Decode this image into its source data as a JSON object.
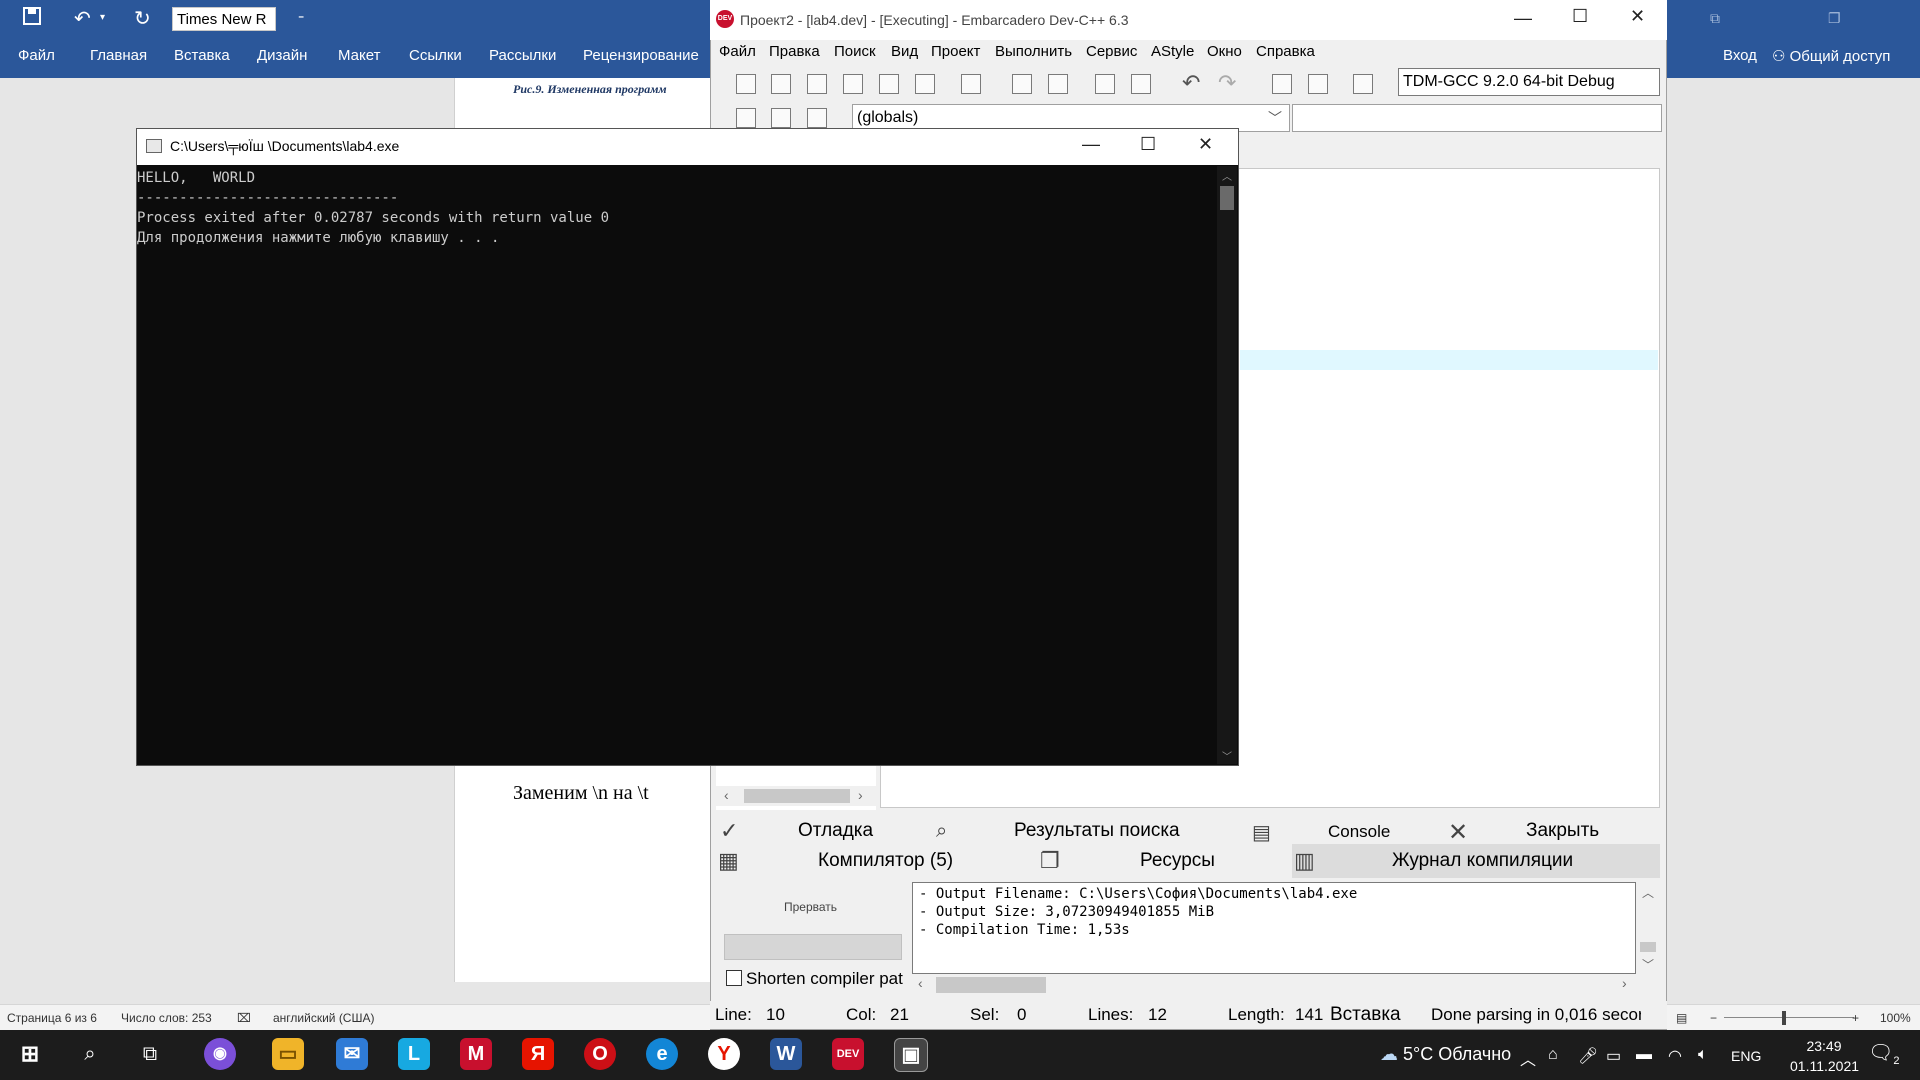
{
  "word": {
    "font_name": "Times New R",
    "menu": [
      "Файл",
      "Главная",
      "Вставка",
      "Дизайн",
      "Макет",
      "Ссылки",
      "Рассылки",
      "Рецензирование"
    ],
    "login": "Вход",
    "share": "Общий доступ",
    "caption": "Рис.9. Измененная программ",
    "doc_text": "Заменим \\n на \\t",
    "status": {
      "page": "Страница 6 из 6",
      "words": "Число слов: 253",
      "language": "английский (США)",
      "zoom": "100%"
    }
  },
  "devcpp": {
    "title": "Проект2 - [lab4.dev] - [Executing] - Embarcadero Dev-C++ 6.3",
    "logo": "DEV C++",
    "menu": [
      "Файл",
      "Правка",
      "Поиск",
      "Вид",
      "Проект",
      "Выполнить",
      "Сервис",
      "AStyle",
      "Окно",
      "Справка"
    ],
    "compiler": "TDM-GCC 9.2.0 64-bit Debug",
    "globals": "(globals)",
    "tabs": {
      "debug": "Отладка",
      "search_results": "Результаты поиска",
      "console": "Console",
      "close": "Закрыть",
      "compiler": "Компилятор (5)",
      "resources": "Ресурсы",
      "compile_log": "Журнал компиляции"
    },
    "abort": "Прервать",
    "shorten": "Shorten compiler pat",
    "log": [
      "- Output Filename: C:\\Users\\София\\Documents\\lab4.exe",
      "- Output Size: 3,07230949401855 MiB",
      "- Compilation Time: 1,53s"
    ],
    "status": {
      "line_label": "Line:",
      "line": "10",
      "col_label": "Col:",
      "col": "21",
      "sel_label": "Sel:",
      "sel": "0",
      "lines_label": "Lines:",
      "lines": "12",
      "length_label": "Length:",
      "length": "141",
      "mode": "Вставка",
      "parsing": "Done parsing in 0,016 secor"
    }
  },
  "console": {
    "title": "C:\\Users\\╤юЇш \\Documents\\lab4.exe",
    "lines": [
      "HELLO,   WORLD",
      "-------------------------------",
      "Process exited after 0.02787 seconds with return value 0",
      "Для продолжения нажмите любую клавишу . . ."
    ]
  },
  "taskbar": {
    "weather": "5°C  Облачно",
    "lang": "ENG",
    "time": "23:49",
    "date": "01.11.2021",
    "notifications": "2"
  }
}
